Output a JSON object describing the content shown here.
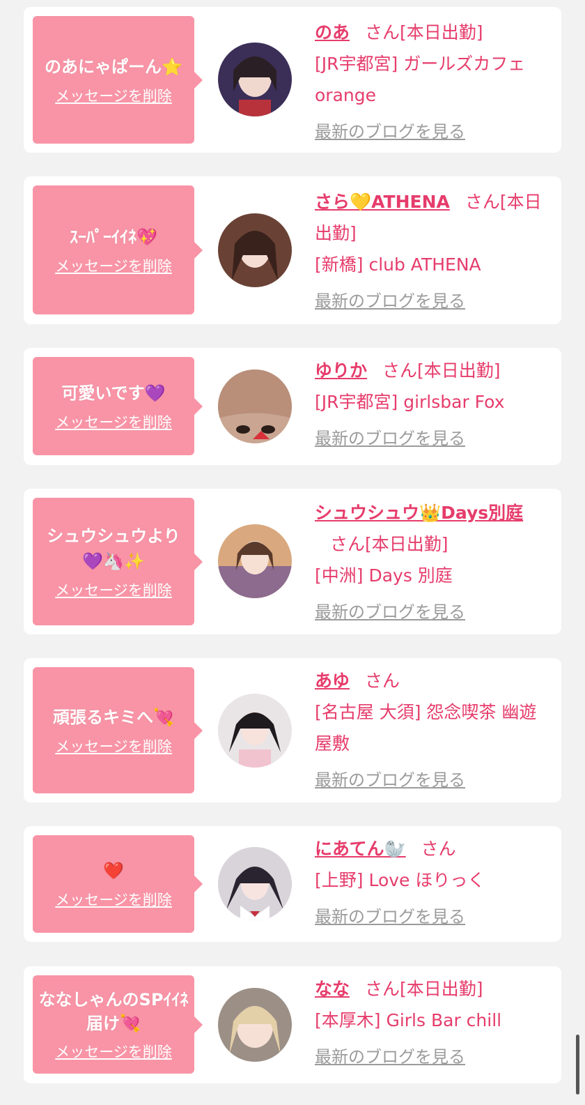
{
  "delete_label": "メッセージを削除",
  "blog_label": "最新のブログを見る",
  "colors": {
    "background": "#f2f2f2",
    "bubble": "#f894a6",
    "accent_text": "#e63c6b",
    "link_gray": "#9b9b9b"
  },
  "messages": [
    {
      "message": "のあにゃぱーん⭐️",
      "name": "のあ",
      "suffix": "さん[本日出勤]",
      "shop": "[JR宇都宮] ガールズカフェ orange"
    },
    {
      "message": "ｽｰﾊﾟｰｲｲﾈ💖",
      "name": "さら💛ATHENA",
      "suffix": "さん[本日出勤]",
      "shop": "[新橋] club ATHENA"
    },
    {
      "message": "可愛いです💜",
      "name": "ゆりか",
      "suffix": "さん[本日出勤]",
      "shop": "[JR宇都宮] girlsbar Fox"
    },
    {
      "message": "シュウシュウより💜🦄✨",
      "name": "シュウシュウ👑Days別庭",
      "suffix": "さん[本日出勤]",
      "shop": "[中洲] Days 別庭"
    },
    {
      "message": "頑張るキミへ💘",
      "name": "あゆ",
      "suffix": "さん",
      "shop": "[名古屋 大須] 怨念喫茶 幽遊屋敷"
    },
    {
      "message": "❤️",
      "name": "にあてん🦭",
      "suffix": "さん",
      "shop": "[上野] Love ほりっく"
    },
    {
      "message": "ななしゃんのSPｲｲﾈ届け💘",
      "name": "なな",
      "suffix": "さん[本日出勤]",
      "shop": "[本厚木] Girls Bar chill"
    }
  ]
}
